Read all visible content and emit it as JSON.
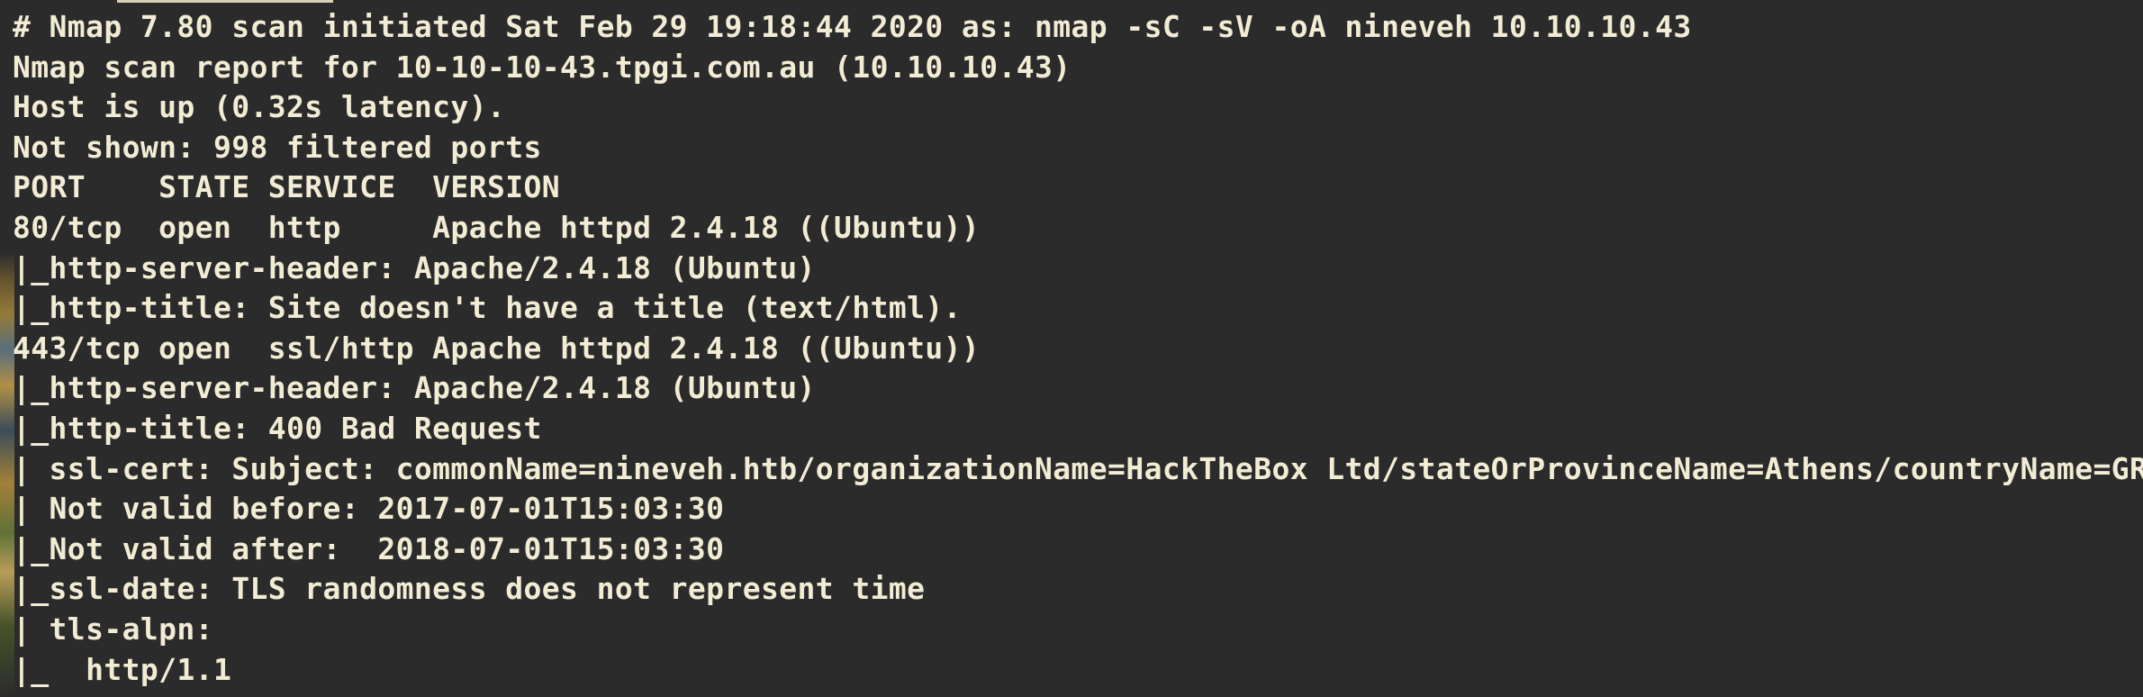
{
  "terminal": {
    "lines": [
      "# Nmap 7.80 scan initiated Sat Feb 29 19:18:44 2020 as: nmap -sC -sV -oA nineveh 10.10.10.43",
      "Nmap scan report for 10-10-10-43.tpgi.com.au (10.10.10.43)",
      "Host is up (0.32s latency).",
      "Not shown: 998 filtered ports",
      "PORT    STATE SERVICE  VERSION",
      "80/tcp  open  http     Apache httpd 2.4.18 ((Ubuntu))",
      "|_http-server-header: Apache/2.4.18 (Ubuntu)",
      "|_http-title: Site doesn't have a title (text/html).",
      "443/tcp open  ssl/http Apache httpd 2.4.18 ((Ubuntu))",
      "|_http-server-header: Apache/2.4.18 (Ubuntu)",
      "|_http-title: 400 Bad Request",
      "| ssl-cert: Subject: commonName=nineveh.htb/organizationName=HackTheBox Ltd/stateOrProvinceName=Athens/countryName=GR",
      "| Not valid before: 2017-07-01T15:03:30",
      "|_Not valid after:  2018-07-01T15:03:30",
      "|_ssl-date: TLS randomness does not represent time",
      "| tls-alpn: ",
      "|_  http/1.1"
    ]
  },
  "colors": {
    "background": "#2b2b2b",
    "foreground": "#f2ecd4"
  }
}
